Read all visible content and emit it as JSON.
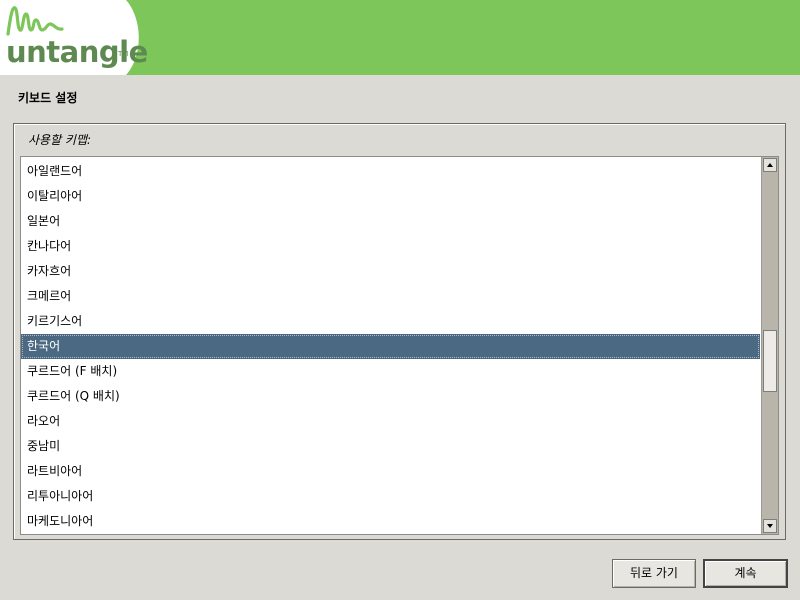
{
  "header": {
    "brand_text": "untangle",
    "brand_tm": "TM",
    "brand_color": "#7cc65a"
  },
  "page": {
    "title": "키보드 설정"
  },
  "keymap": {
    "label": "사용할 키맵:",
    "items": [
      {
        "label": "아일랜드어"
      },
      {
        "label": "이탈리아어"
      },
      {
        "label": "일본어"
      },
      {
        "label": "칸나다어"
      },
      {
        "label": "카자흐어"
      },
      {
        "label": "크메르어"
      },
      {
        "label": "키르기스어"
      },
      {
        "label": "한국어"
      },
      {
        "label": "쿠르드어 (F 배치)"
      },
      {
        "label": "쿠르드어 (Q 배치)"
      },
      {
        "label": "라오어"
      },
      {
        "label": "중남미"
      },
      {
        "label": "라트비아어"
      },
      {
        "label": "리투아니아어"
      },
      {
        "label": "마케도니아어"
      }
    ],
    "selected_label": "한국어",
    "selected_color": "#4b6983"
  },
  "buttons": {
    "back_label": "뒤로 가기",
    "continue_label": "계속"
  }
}
